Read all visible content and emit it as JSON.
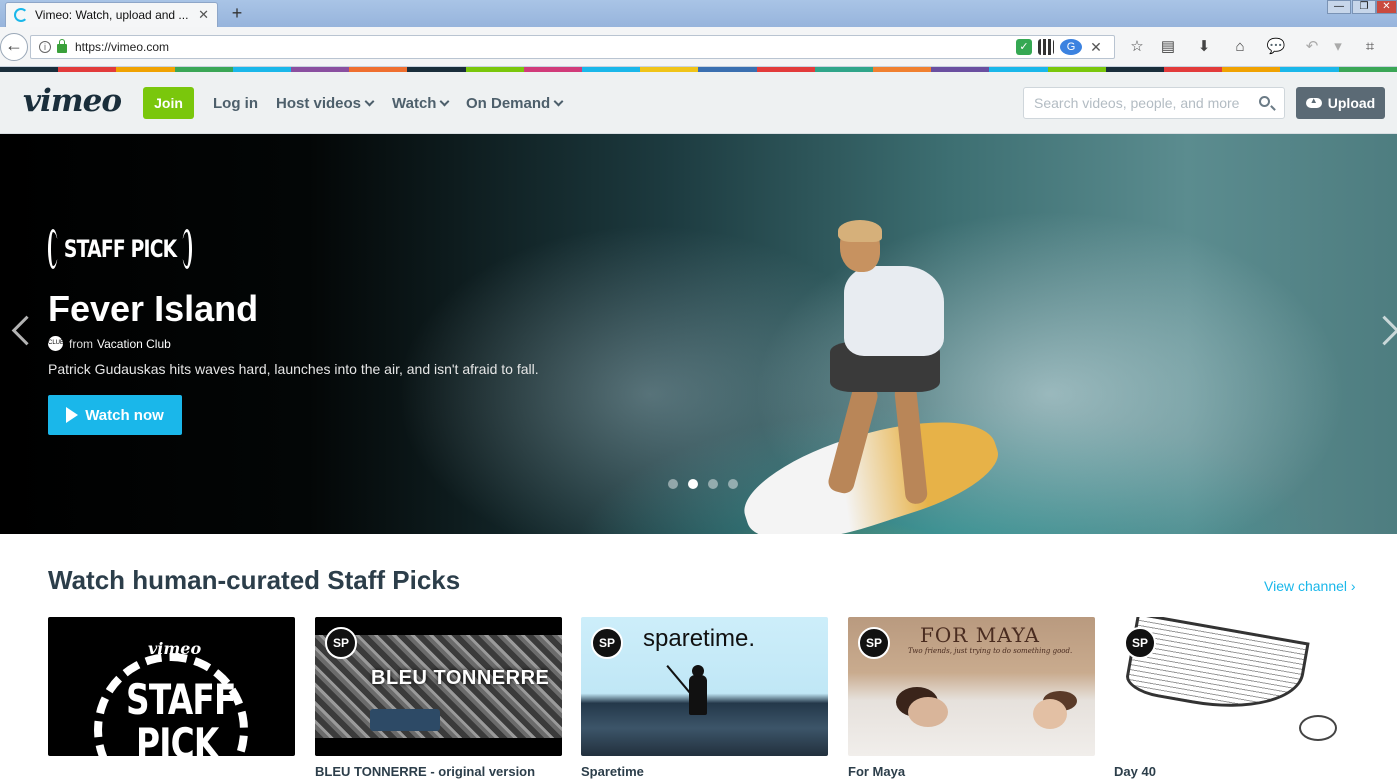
{
  "browser": {
    "tab_title": "Vimeo: Watch, upload and ...",
    "tab_close": "✕",
    "new_tab": "+",
    "window_min": "—",
    "window_max": "❐",
    "window_close": "✕",
    "back": "←",
    "url": "https://vimeo.com",
    "url_info": "i",
    "ext_clear": "✕",
    "toolbar_icons": [
      "star-icon",
      "reading-list-icon",
      "download-icon",
      "home-icon",
      "chat-icon",
      "undo-icon",
      "chevron-down-icon",
      "crop-icon"
    ],
    "toolbar_glyphs": {
      "star": "☆",
      "reading": "▤",
      "download": "⬇",
      "home": "⌂",
      "chat": "💬",
      "undo": "↶",
      "dropdown": "▾",
      "crop": "⌗"
    },
    "stripe_colors": [
      "#1a2e3b",
      "#e23b3b",
      "#f0a202",
      "#3aa656",
      "#1ab7ea",
      "#8a4fa0",
      "#ef6f2f",
      "#1a2e3b",
      "#7ac70c",
      "#d13b7a",
      "#1ab7ea",
      "#f0c419",
      "#3a6fb0",
      "#e23b3b",
      "#2fa58a",
      "#f08030",
      "#6a4fa0",
      "#1ab7ea",
      "#7ac70c",
      "#1a2e3b",
      "#e23b3b",
      "#f0a202",
      "#1ab7ea",
      "#3aa656"
    ]
  },
  "header": {
    "logo": "vimeo",
    "join": "Join",
    "login": "Log in",
    "nav": [
      "Host videos",
      "Watch",
      "On Demand"
    ],
    "search_placeholder": "Search videos, people, and more",
    "upload": "Upload",
    "accent": "#1ab7ea",
    "join_color": "#7ac70c"
  },
  "hero": {
    "badge": "STAFF PICK",
    "title": "Fever Island",
    "from_label": "from",
    "creator": "Vacation Club",
    "creator_avatar": "CLUB",
    "description": "Patrick Gudauskas hits waves hard, launches into the air, and isn't afraid to fall.",
    "watch_label": "Watch now",
    "slide_count": 4,
    "active_slide": 2
  },
  "staff_picks": {
    "title": "Watch human-curated Staff Picks",
    "view_channel": "View channel ›",
    "sp_badge": "SP",
    "cards": [
      {
        "caption": "",
        "logo_word": "vimeo",
        "line1": "STAFF",
        "line2": "PICK"
      },
      {
        "caption": "BLEU TONNERRE - original version",
        "thumb_text": "BLEU TONNERRE"
      },
      {
        "caption": "Sparetime",
        "thumb_text": "sparetime."
      },
      {
        "caption": "For Maya",
        "thumb_text": "FOR MAYA",
        "thumb_sub": "Two friends, just trying to do something good."
      },
      {
        "caption": "Day 40"
      }
    ]
  }
}
